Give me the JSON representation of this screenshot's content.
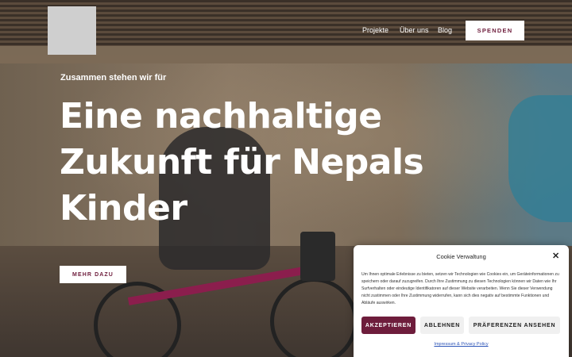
{
  "header": {
    "nav": [
      "Projekte",
      "Über uns",
      "Blog"
    ],
    "donate_label": "SPENDEN"
  },
  "hero": {
    "kicker": "Zusammen stehen wir für",
    "headline": "Eine nachhaltige Zukunft für Nepals Kinder",
    "cta_label": "MEHR DAZU"
  },
  "cookie_banner": {
    "title": "Cookie Verwaltung",
    "text": "Um Ihnen optimale Erlebnisse zu bieten, setzen wir Technologien wie Cookies ein, um Geräteinformationen zu speichern oder darauf zuzugreifen. Durch Ihre Zustimmung zu diesen Technologien können wir Daten wie Ihr Surfverhalten oder eindeutige Identifikatoren auf dieser Website verarbeiten. Wenn Sie dieser Verwendung nicht zustimmen oder Ihre Zustimmung widerrufen, kann sich dies negativ auf bestimmte Funktionen und Abläufe auswirken.",
    "accept_label": "AKZEPTIEREN",
    "deny_label": "ABLEHNEN",
    "prefs_label": "PRÄFERENZEN ANSEHEN",
    "link_label": "Impressum & Privacy Policy"
  },
  "colors": {
    "accent": "#6e1d3c",
    "link": "#2d55b8"
  },
  "icons": {
    "close": "close-icon"
  }
}
